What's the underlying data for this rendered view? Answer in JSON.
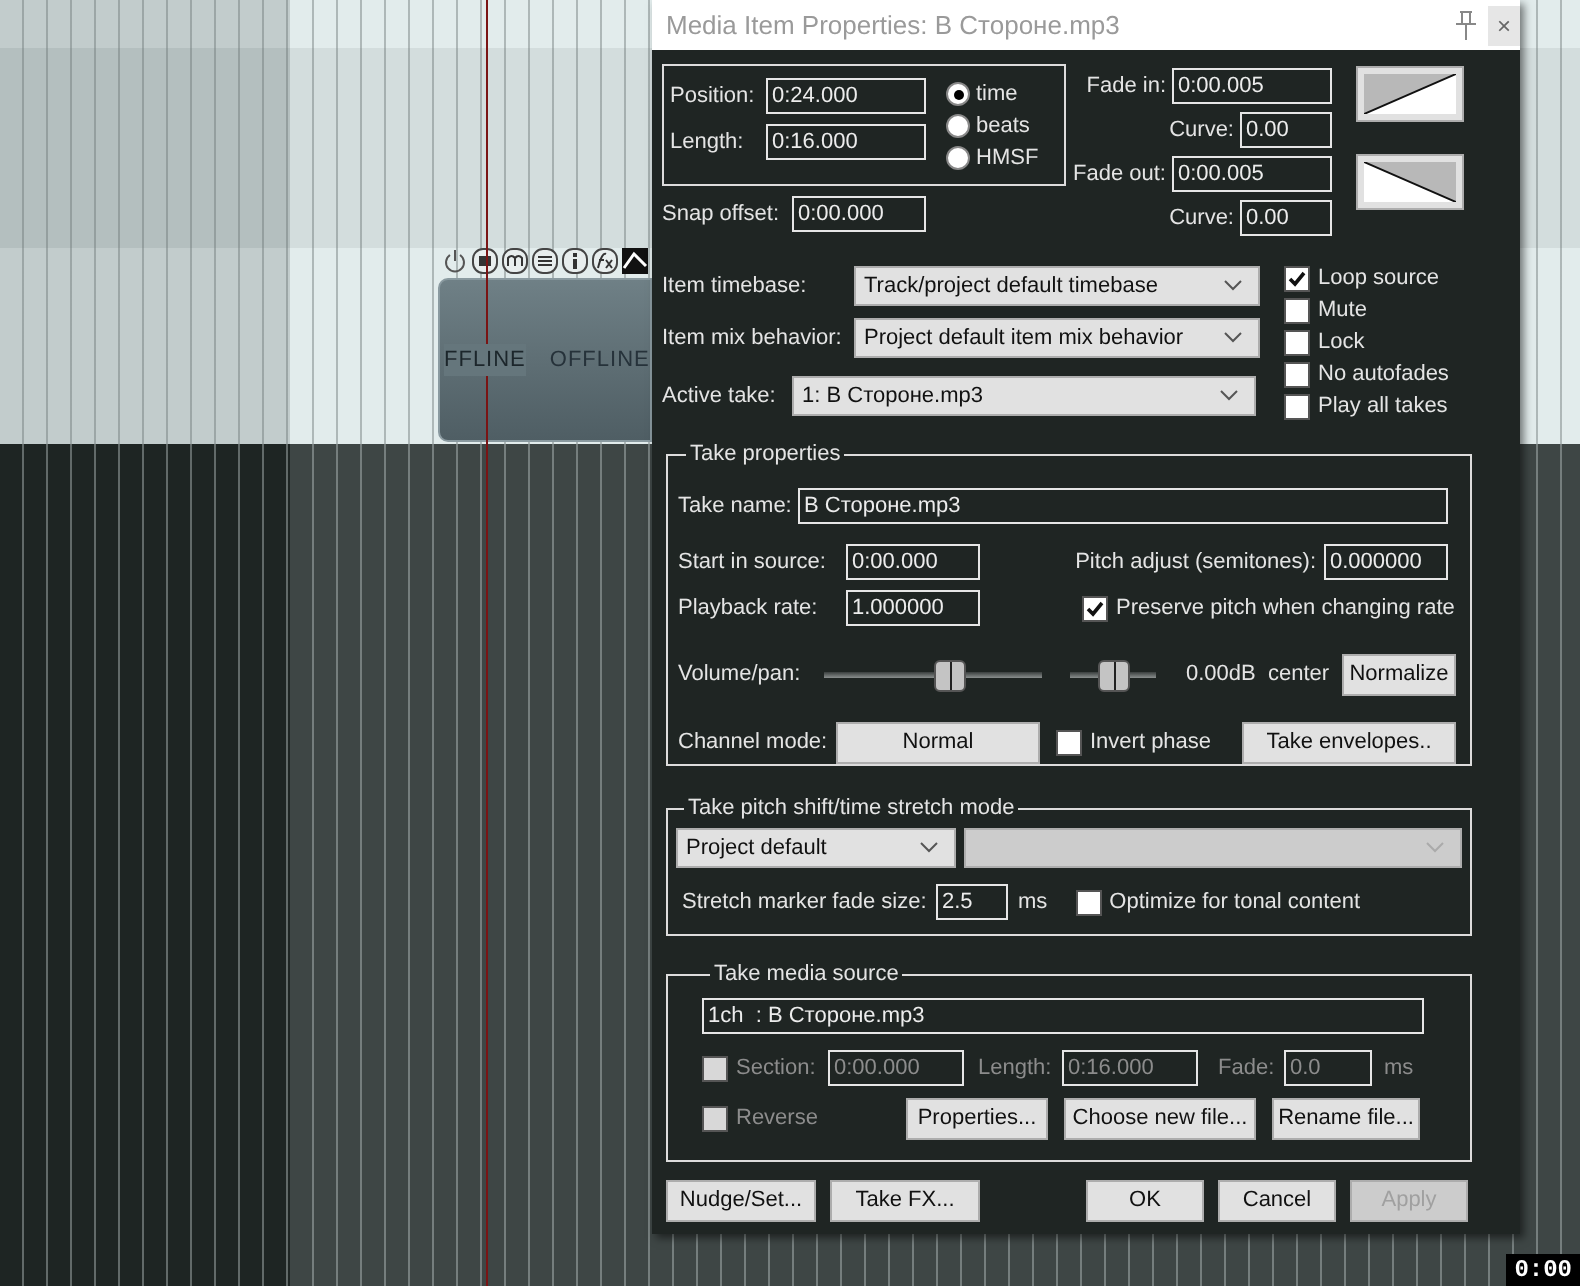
{
  "arrange": {
    "item_labels": [
      "FFLINE",
      "OFFLINE"
    ],
    "time_display": "0:00"
  },
  "dialog": {
    "title": "Media Item Properties:  В Стороне.mp3",
    "close_label": "×",
    "position": {
      "label": "Position:",
      "value": "0:24.000"
    },
    "length": {
      "label": "Length:",
      "value": "0:16.000"
    },
    "time_modes": [
      {
        "label": "time",
        "selected": true
      },
      {
        "label": "beats",
        "selected": false
      },
      {
        "label": "HMSF",
        "selected": false
      }
    ],
    "fade_in": {
      "label": "Fade in:",
      "value": "0:00.005",
      "curve_label": "Curve:",
      "curve": "0.00"
    },
    "fade_out": {
      "label": "Fade out:",
      "value": "0:00.005",
      "curve_label": "Curve:",
      "curve": "0.00"
    },
    "snap_offset": {
      "label": "Snap offset:",
      "value": "0:00.000"
    },
    "dropdowns": [
      {
        "label": "Item timebase:",
        "value": "Track/project default timebase"
      },
      {
        "label": "Item mix behavior:",
        "value": "Project default item mix behavior"
      },
      {
        "label": "Active take:",
        "value": "1: В Стороне.mp3"
      }
    ],
    "flags": [
      {
        "label": "Loop source",
        "checked": true
      },
      {
        "label": "Mute",
        "checked": false
      },
      {
        "label": "Lock",
        "checked": false
      },
      {
        "label": "No autofades",
        "checked": false
      },
      {
        "label": "Play all takes",
        "checked": false
      }
    ],
    "take_properties": {
      "title": "Take properties",
      "take_name": {
        "label": "Take name:",
        "value": "В Стороне.mp3"
      },
      "start_in_source": {
        "label": "Start in source:",
        "value": "0:00.000"
      },
      "pitch_adjust": {
        "label": "Pitch adjust (semitones):",
        "value": "0.000000"
      },
      "playback_rate": {
        "label": "Playback rate:",
        "value": "1.000000"
      },
      "preserve_pitch": {
        "label": "Preserve pitch when changing rate",
        "checked": true
      },
      "volume_pan": {
        "label": "Volume/pan:",
        "volume": {
          "level": 0.58
        },
        "pan": {
          "level": 0.5
        },
        "reading": "0.00dB  center"
      },
      "normalize": "Normalize",
      "channel_mode": {
        "label": "Channel mode:",
        "value": "Normal"
      },
      "invert_phase": {
        "label": "Invert phase",
        "checked": false
      },
      "take_envelopes": "Take envelopes.."
    },
    "pitch_shift": {
      "title": "Take pitch shift/time stretch mode",
      "mode": "Project default",
      "submode_disabled": true,
      "fade_size": {
        "label": "Stretch marker fade size:",
        "value": "2.5",
        "unit": "ms"
      },
      "optimize": {
        "label": "Optimize for tonal content",
        "checked": false
      }
    },
    "media_source": {
      "title": "Take media source",
      "source": "1ch  : В Стороне.mp3",
      "section": {
        "label": "Section:",
        "checked": false,
        "disabled": true,
        "value": "0:00.000",
        "length_label": "Length:",
        "length": "0:16.000",
        "fade_label": "Fade:",
        "fade": "0.0",
        "unit": "ms"
      },
      "reverse": {
        "label": "Reverse",
        "checked": false,
        "disabled": true
      },
      "buttons": [
        "Properties...",
        "Choose new file...",
        "Rename file..."
      ]
    },
    "left_buttons": [
      {
        "label": "Nudge/Set...",
        "disabled": false
      },
      {
        "label": "Take FX...",
        "disabled": false
      }
    ],
    "right_buttons": [
      {
        "label": "OK",
        "disabled": false
      },
      {
        "label": "Cancel",
        "disabled": false
      },
      {
        "label": "Apply",
        "disabled": true
      }
    ]
  }
}
